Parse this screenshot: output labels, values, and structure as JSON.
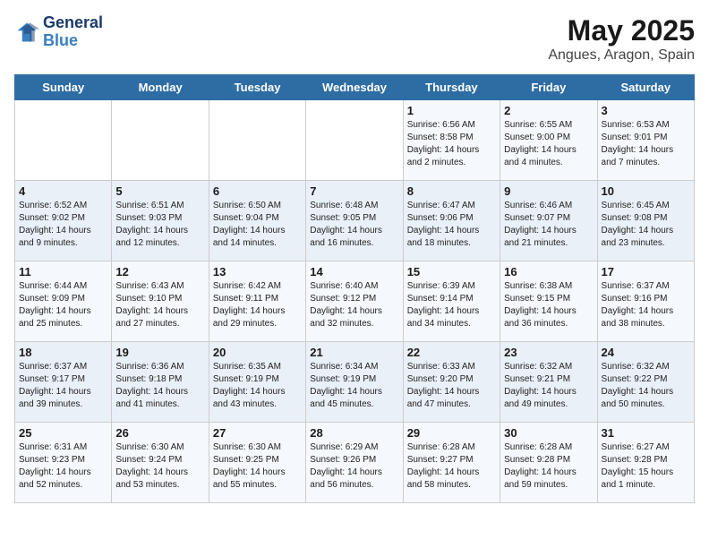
{
  "header": {
    "logo_line1": "General",
    "logo_line2": "Blue",
    "title": "May 2025",
    "subtitle": "Angues, Aragon, Spain"
  },
  "weekdays": [
    "Sunday",
    "Monday",
    "Tuesday",
    "Wednesday",
    "Thursday",
    "Friday",
    "Saturday"
  ],
  "weeks": [
    [
      {
        "day": "",
        "info": ""
      },
      {
        "day": "",
        "info": ""
      },
      {
        "day": "",
        "info": ""
      },
      {
        "day": "",
        "info": ""
      },
      {
        "day": "1",
        "info": "Sunrise: 6:56 AM\nSunset: 8:58 PM\nDaylight: 14 hours\nand 2 minutes."
      },
      {
        "day": "2",
        "info": "Sunrise: 6:55 AM\nSunset: 9:00 PM\nDaylight: 14 hours\nand 4 minutes."
      },
      {
        "day": "3",
        "info": "Sunrise: 6:53 AM\nSunset: 9:01 PM\nDaylight: 14 hours\nand 7 minutes."
      }
    ],
    [
      {
        "day": "4",
        "info": "Sunrise: 6:52 AM\nSunset: 9:02 PM\nDaylight: 14 hours\nand 9 minutes."
      },
      {
        "day": "5",
        "info": "Sunrise: 6:51 AM\nSunset: 9:03 PM\nDaylight: 14 hours\nand 12 minutes."
      },
      {
        "day": "6",
        "info": "Sunrise: 6:50 AM\nSunset: 9:04 PM\nDaylight: 14 hours\nand 14 minutes."
      },
      {
        "day": "7",
        "info": "Sunrise: 6:48 AM\nSunset: 9:05 PM\nDaylight: 14 hours\nand 16 minutes."
      },
      {
        "day": "8",
        "info": "Sunrise: 6:47 AM\nSunset: 9:06 PM\nDaylight: 14 hours\nand 18 minutes."
      },
      {
        "day": "9",
        "info": "Sunrise: 6:46 AM\nSunset: 9:07 PM\nDaylight: 14 hours\nand 21 minutes."
      },
      {
        "day": "10",
        "info": "Sunrise: 6:45 AM\nSunset: 9:08 PM\nDaylight: 14 hours\nand 23 minutes."
      }
    ],
    [
      {
        "day": "11",
        "info": "Sunrise: 6:44 AM\nSunset: 9:09 PM\nDaylight: 14 hours\nand 25 minutes."
      },
      {
        "day": "12",
        "info": "Sunrise: 6:43 AM\nSunset: 9:10 PM\nDaylight: 14 hours\nand 27 minutes."
      },
      {
        "day": "13",
        "info": "Sunrise: 6:42 AM\nSunset: 9:11 PM\nDaylight: 14 hours\nand 29 minutes."
      },
      {
        "day": "14",
        "info": "Sunrise: 6:40 AM\nSunset: 9:12 PM\nDaylight: 14 hours\nand 32 minutes."
      },
      {
        "day": "15",
        "info": "Sunrise: 6:39 AM\nSunset: 9:14 PM\nDaylight: 14 hours\nand 34 minutes."
      },
      {
        "day": "16",
        "info": "Sunrise: 6:38 AM\nSunset: 9:15 PM\nDaylight: 14 hours\nand 36 minutes."
      },
      {
        "day": "17",
        "info": "Sunrise: 6:37 AM\nSunset: 9:16 PM\nDaylight: 14 hours\nand 38 minutes."
      }
    ],
    [
      {
        "day": "18",
        "info": "Sunrise: 6:37 AM\nSunset: 9:17 PM\nDaylight: 14 hours\nand 39 minutes."
      },
      {
        "day": "19",
        "info": "Sunrise: 6:36 AM\nSunset: 9:18 PM\nDaylight: 14 hours\nand 41 minutes."
      },
      {
        "day": "20",
        "info": "Sunrise: 6:35 AM\nSunset: 9:19 PM\nDaylight: 14 hours\nand 43 minutes."
      },
      {
        "day": "21",
        "info": "Sunrise: 6:34 AM\nSunset: 9:19 PM\nDaylight: 14 hours\nand 45 minutes."
      },
      {
        "day": "22",
        "info": "Sunrise: 6:33 AM\nSunset: 9:20 PM\nDaylight: 14 hours\nand 47 minutes."
      },
      {
        "day": "23",
        "info": "Sunrise: 6:32 AM\nSunset: 9:21 PM\nDaylight: 14 hours\nand 49 minutes."
      },
      {
        "day": "24",
        "info": "Sunrise: 6:32 AM\nSunset: 9:22 PM\nDaylight: 14 hours\nand 50 minutes."
      }
    ],
    [
      {
        "day": "25",
        "info": "Sunrise: 6:31 AM\nSunset: 9:23 PM\nDaylight: 14 hours\nand 52 minutes."
      },
      {
        "day": "26",
        "info": "Sunrise: 6:30 AM\nSunset: 9:24 PM\nDaylight: 14 hours\nand 53 minutes."
      },
      {
        "day": "27",
        "info": "Sunrise: 6:30 AM\nSunset: 9:25 PM\nDaylight: 14 hours\nand 55 minutes."
      },
      {
        "day": "28",
        "info": "Sunrise: 6:29 AM\nSunset: 9:26 PM\nDaylight: 14 hours\nand 56 minutes."
      },
      {
        "day": "29",
        "info": "Sunrise: 6:28 AM\nSunset: 9:27 PM\nDaylight: 14 hours\nand 58 minutes."
      },
      {
        "day": "30",
        "info": "Sunrise: 6:28 AM\nSunset: 9:28 PM\nDaylight: 14 hours\nand 59 minutes."
      },
      {
        "day": "31",
        "info": "Sunrise: 6:27 AM\nSunset: 9:28 PM\nDaylight: 15 hours\nand 1 minute."
      }
    ]
  ]
}
